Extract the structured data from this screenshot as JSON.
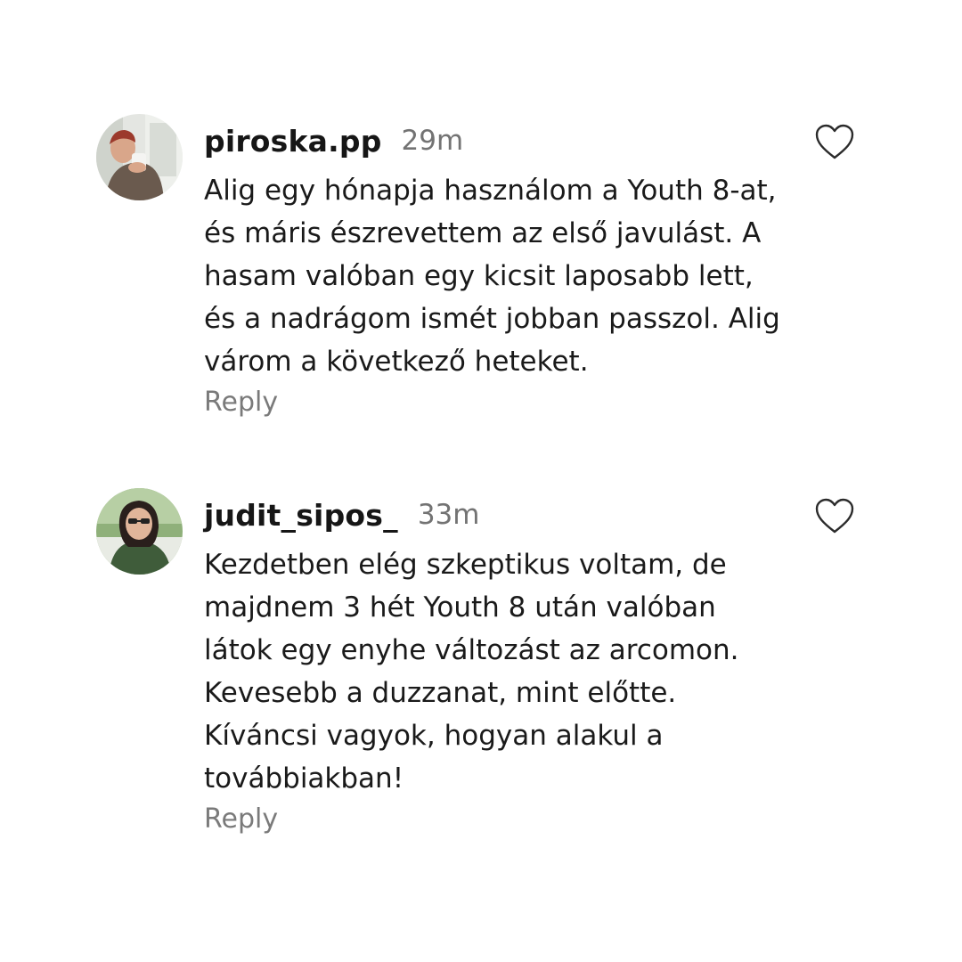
{
  "comments": [
    {
      "username": "piroska.pp",
      "time": "29m",
      "lines": [
        "Alig egy hónapja használom a Youth 8-at,",
        "és máris észrevettem az első javulást. A",
        "hasam valóban egy kicsit laposabb lett,",
        "és a nadrágom ismét jobban passzol. Alig",
        "várom a következő heteket."
      ],
      "reply_label": "Reply",
      "like_icon": "heart-outline-icon"
    },
    {
      "username": "judit_sipos_",
      "time": "33m",
      "lines": [
        "Kezdetben elég szkeptikus voltam, de",
        "majdnem 3 hét Youth 8 után valóban",
        "látok egy enyhe változást az arcomon.",
        "Kevesebb a duzzanat, mint előtte.",
        "Kíváncsi vagyok, hogyan alakul a",
        "továbbiakban!"
      ],
      "reply_label": "Reply",
      "like_icon": "heart-outline-icon"
    }
  ]
}
